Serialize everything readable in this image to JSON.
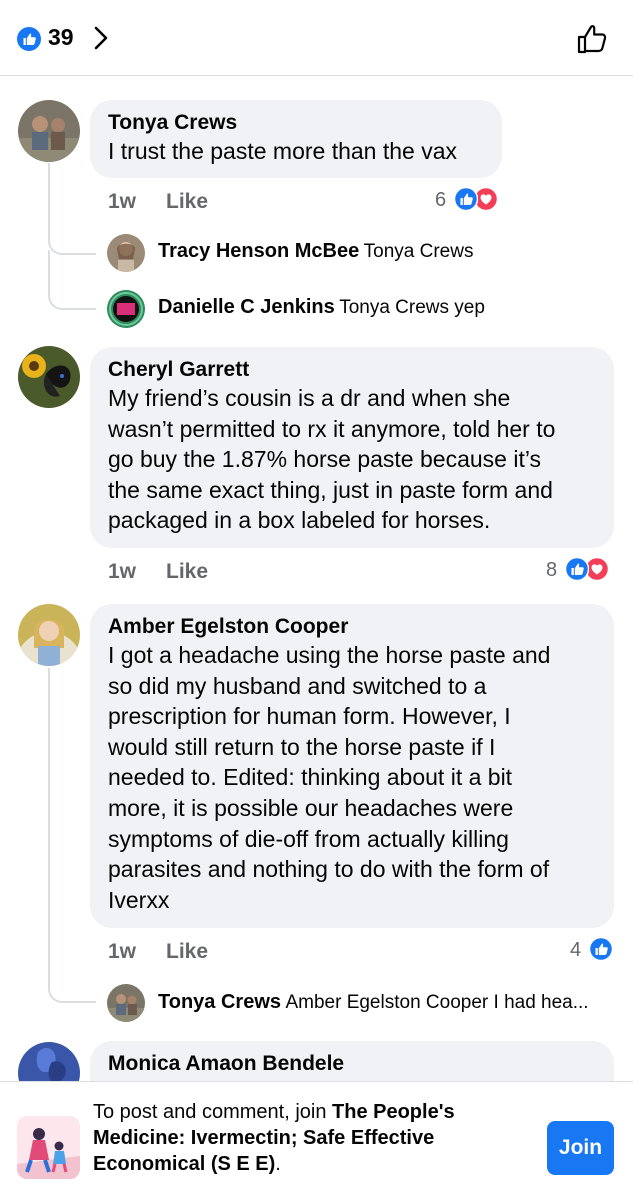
{
  "header": {
    "reaction_count": "39",
    "reaction_icon": "like-icon",
    "chevron_icon": "chevron-right-icon",
    "like_outline_icon": "thumbs-up-outline-icon"
  },
  "comments": [
    {
      "author": "Tonya Crews",
      "text": "I trust the paste more than the vax",
      "time": "1w",
      "like_label": "Like",
      "reaction_count": "6",
      "reactions": [
        "like",
        "love"
      ],
      "replies": [
        {
          "author": "Tracy Henson McBee",
          "text": "Tonya Crews"
        },
        {
          "author": "Danielle C Jenkins",
          "text": "Tonya Crews yep"
        }
      ]
    },
    {
      "author": "Cheryl Garrett",
      "text": "My friend’s cousin is a dr and when she\nwasn’t permitted to rx it anymore, told her to\ngo buy the 1.87% horse paste because it’s\nthe same exact thing, just in paste form and\npackaged in a box labeled for horses.",
      "time": "1w",
      "like_label": "Like",
      "reaction_count": "8",
      "reactions": [
        "like",
        "love"
      ]
    },
    {
      "author": "Amber Egelston Cooper",
      "text": "I got a headache using the horse paste and\nso did my husband and switched to a\nprescription for human form. However, I\nwould still return to the horse paste if I\nneeded to. Edited: thinking about it a bit\nmore, it is possible our headaches were\nsymptoms of die-off from actually killing\nparasites and nothing to do with the form of\nIverxx",
      "time": "1w",
      "like_label": "Like",
      "reaction_count": "4",
      "reactions": [
        "like"
      ],
      "replies": [
        {
          "author": "Tonya Crews",
          "text": "Amber Egelston Cooper I had hea..."
        }
      ]
    },
    {
      "author": "Monica Amaon Bendele"
    }
  ],
  "join_bar": {
    "prefix": "To post and comment, join ",
    "group_name": "The People's Medicine: Ivermectin; Safe Effective Economical (S E E)",
    "suffix": ".",
    "button_label": "Join"
  },
  "colors": {
    "accent": "#1877f2",
    "love": "#f33e58",
    "bubble": "#f0f2f5",
    "secondary_text": "#65676b"
  }
}
